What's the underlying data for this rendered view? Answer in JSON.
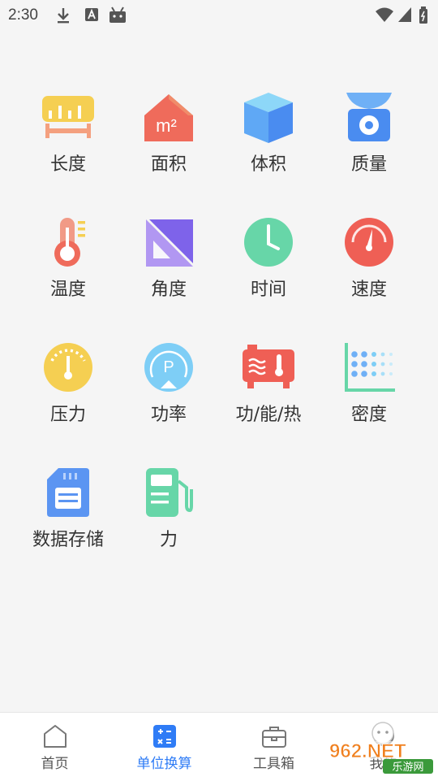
{
  "status_bar": {
    "time": "2:30"
  },
  "units": [
    {
      "label": "长度"
    },
    {
      "label": "面积"
    },
    {
      "label": "体积"
    },
    {
      "label": "质量"
    },
    {
      "label": "温度"
    },
    {
      "label": "角度"
    },
    {
      "label": "时间"
    },
    {
      "label": "速度"
    },
    {
      "label": "压力"
    },
    {
      "label": "功率"
    },
    {
      "label": "功/能/热"
    },
    {
      "label": "密度"
    },
    {
      "label": "数据存储"
    },
    {
      "label": "力"
    }
  ],
  "area_icon_text": "m²",
  "power_icon_text": "P",
  "bottom_nav": {
    "items": [
      {
        "label": "首页"
      },
      {
        "label": "单位换算"
      },
      {
        "label": "工具箱"
      },
      {
        "label": "我的"
      }
    ],
    "active_index": 1
  },
  "watermark": {
    "brand": "962.NET",
    "sub": "乐游网"
  },
  "colors": {
    "accent": "#2f7cf6"
  }
}
